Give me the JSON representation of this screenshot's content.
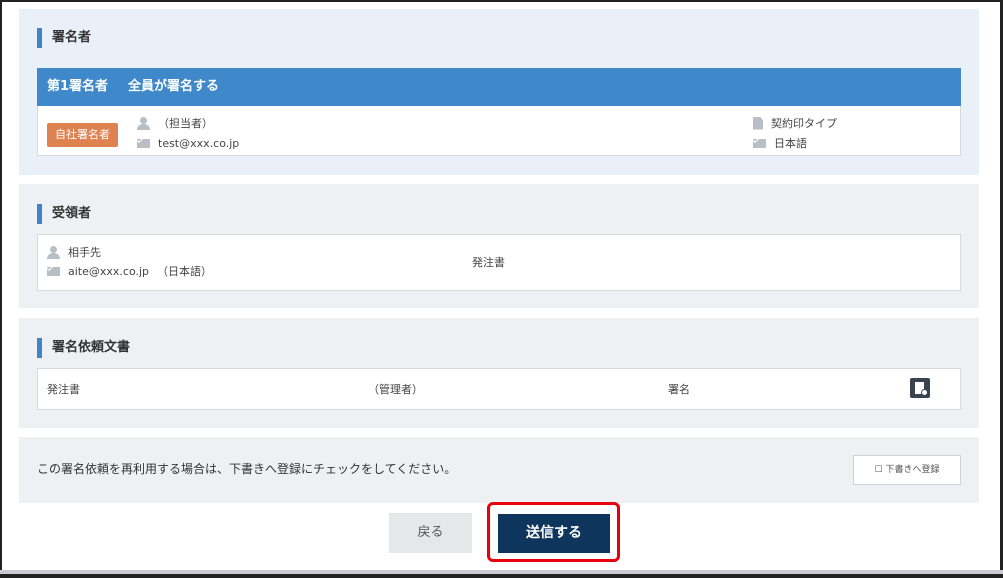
{
  "signers_section": {
    "title": "署名者",
    "header": {
      "order": "第1署名者",
      "rule": "全員が署名する"
    },
    "signer": {
      "badge": "自社署名者",
      "name": "（担当者）",
      "email": "test@xxx.co.jp",
      "seal_type": "契約印タイプ",
      "language": "日本語"
    }
  },
  "recipients_section": {
    "title": "受領者",
    "recipient": {
      "name": "相手先",
      "email": "aite@xxx.co.jp",
      "language": "（日本語）",
      "document": "発注書"
    }
  },
  "documents_section": {
    "title": "署名依頼文書",
    "document": {
      "name": "発注書",
      "role": "（管理者）",
      "action": "署名"
    }
  },
  "draft": {
    "note": "この署名依頼を再利用する場合は、下書きへ登録にチェックをしてください。",
    "checkbox_label": "☐ 下書きへ登録"
  },
  "actions": {
    "back_label": "戻る",
    "send_label": "送信する"
  },
  "colors": {
    "accent_blue": "#3f88c9",
    "badge_orange": "#de8250",
    "send_navy": "#0e355b",
    "highlight_red": "#e8000d"
  }
}
